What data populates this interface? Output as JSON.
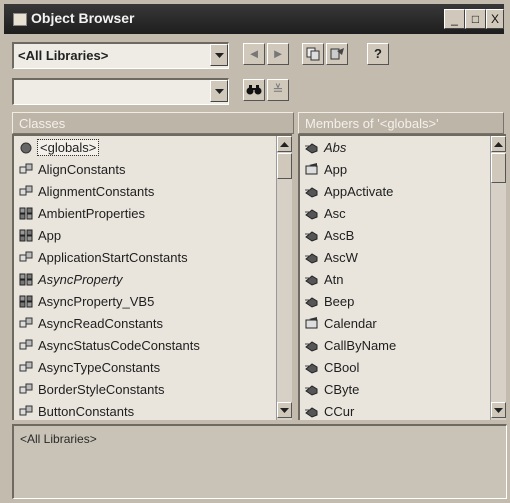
{
  "window": {
    "title": "Object Browser"
  },
  "titlebar_buttons": [
    "_",
    "□",
    "X"
  ],
  "library_combo": {
    "value": "<All Libraries>"
  },
  "search_combo": {
    "value": ""
  },
  "toolbar": {
    "back": "◄",
    "forward": "►",
    "copy": "copy-icon",
    "view_definition": "view-definition-icon",
    "help": "?",
    "search": "binoculars-icon",
    "toggle_results": "≚"
  },
  "classes": {
    "header": "Classes",
    "items": [
      {
        "label": "<globals>",
        "icon": "globe-icon",
        "italic": false,
        "selected": true
      },
      {
        "label": "AlignConstants",
        "icon": "enum-icon",
        "italic": false
      },
      {
        "label": "AlignmentConstants",
        "icon": "enum-icon",
        "italic": false
      },
      {
        "label": "AmbientProperties",
        "icon": "class-icon",
        "italic": false
      },
      {
        "label": "App",
        "icon": "class-icon",
        "italic": false
      },
      {
        "label": "ApplicationStartConstants",
        "icon": "enum-icon",
        "italic": false
      },
      {
        "label": "AsyncProperty",
        "icon": "class-icon",
        "italic": true
      },
      {
        "label": "AsyncProperty_VB5",
        "icon": "class-icon",
        "italic": false
      },
      {
        "label": "AsyncReadConstants",
        "icon": "enum-icon",
        "italic": false
      },
      {
        "label": "AsyncStatusCodeConstants",
        "icon": "enum-icon",
        "italic": false
      },
      {
        "label": "AsyncTypeConstants",
        "icon": "enum-icon",
        "italic": false
      },
      {
        "label": "BorderStyleConstants",
        "icon": "enum-icon",
        "italic": false
      },
      {
        "label": "ButtonConstants",
        "icon": "enum-icon",
        "italic": false
      }
    ]
  },
  "members": {
    "header": "Members of '<globals>'",
    "items": [
      {
        "label": "Abs",
        "icon": "method-icon",
        "italic": true
      },
      {
        "label": "App",
        "icon": "property-icon",
        "italic": false
      },
      {
        "label": "AppActivate",
        "icon": "method-icon",
        "italic": false
      },
      {
        "label": "Asc",
        "icon": "method-icon",
        "italic": false
      },
      {
        "label": "AscB",
        "icon": "method-icon",
        "italic": false
      },
      {
        "label": "AscW",
        "icon": "method-icon",
        "italic": false
      },
      {
        "label": "Atn",
        "icon": "method-icon",
        "italic": false
      },
      {
        "label": "Beep",
        "icon": "method-icon",
        "italic": false
      },
      {
        "label": "Calendar",
        "icon": "property-icon",
        "italic": false
      },
      {
        "label": "CallByName",
        "icon": "method-icon",
        "italic": false
      },
      {
        "label": "CBool",
        "icon": "method-icon",
        "italic": false
      },
      {
        "label": "CByte",
        "icon": "method-icon",
        "italic": false
      },
      {
        "label": "CCur",
        "icon": "method-icon",
        "italic": false
      }
    ]
  },
  "details": {
    "text": "<All Libraries>"
  }
}
